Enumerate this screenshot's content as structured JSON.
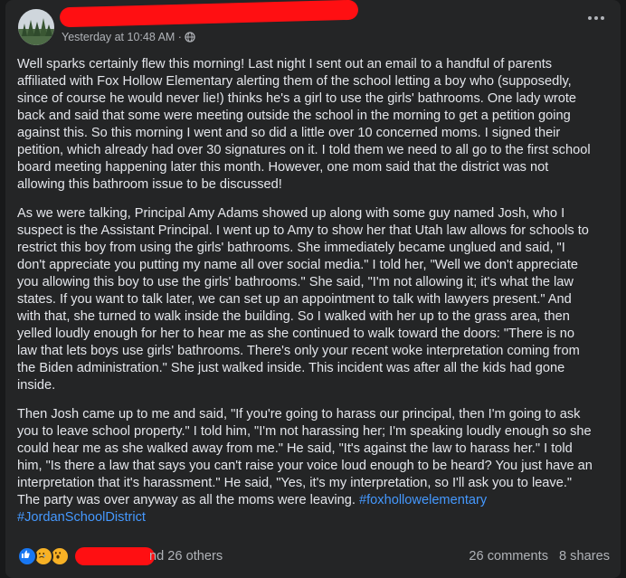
{
  "post": {
    "timestamp": "Yesterday at 10:48 AM ·",
    "paragraphs": [
      "Well sparks certainly flew this morning! Last night I sent out an email to a handful of parents affiliated with Fox Hollow Elementary alerting them of the school letting a boy who (supposedly, since of course he would never lie!) thinks he's a girl to use the girls' bathrooms. One lady wrote back and said that some were meeting outside the school in the morning to get a petition going against this. So this morning I went and so did a little over 10 concerned moms. I signed their petition, which already had over 30 signatures on it. I told them we need to all go to the first school board meeting happening later this month. However, one mom said that the district was not allowing this bathroom issue to be discussed!",
      "As we were talking, Principal Amy Adams showed up along with some guy named Josh, who I suspect is the Assistant Principal. I went up to Amy to show her that Utah law allows for schools to restrict this boy from using the girls' bathrooms. She immediately became unglued and said, \"I don't appreciate you putting my name all over social media.\" I told her, \"Well we don't appreciate you allowing this boy to use the girls' bathrooms.\" She said, \"I'm not allowing it; it's what the law states. If you want to talk later, we can set up an appointment to talk with lawyers present.\" And with that, she turned to walk inside the building. So I walked with her up to the grass area, then yelled loudly enough for her to hear me as she continued to walk toward the doors: \"There is no law that lets boys use girls' bathrooms. There's only your recent woke interpretation coming from the Biden administration.\" She just walked inside. This incident was after all the kids had gone inside.",
      "Then Josh came up to me and said, \"If you're going to harass our principal, then I'm going to ask you to leave school property.\" I told him, \"I'm not harassing her; I'm speaking loudly enough so she could hear me as she walked away from me.\" He said, \"It's against the law to harass her.\" I told him, \"Is there a law that says you can't raise your voice loud enough to be heard? You just have an interpretation that it's harassment.\" He said, \"Yes, it's my interpretation, so I'll ask you to leave.\" The party was over anyway as all the moms were leaving."
    ],
    "hashtags": [
      "#foxhollowelementary",
      "#JordanSchoolDistrict"
    ]
  },
  "footer": {
    "reactors_suffix": "nd 26 others",
    "comments": "26 comments",
    "shares": "8 shares"
  },
  "icons": {
    "reactions": [
      "like-icon",
      "sad-icon",
      "wow-icon"
    ],
    "privacy": "globe-icon",
    "menu": "more-icon"
  },
  "colors": {
    "background": "#18191a",
    "card": "#242526",
    "text": "#e4e6eb",
    "secondary_text": "#b0b3b8",
    "hashtag": "#4599ff",
    "redaction": "#ff0f12",
    "like_blue": "#1877f2",
    "emoji_yellow": "#f7b125"
  }
}
